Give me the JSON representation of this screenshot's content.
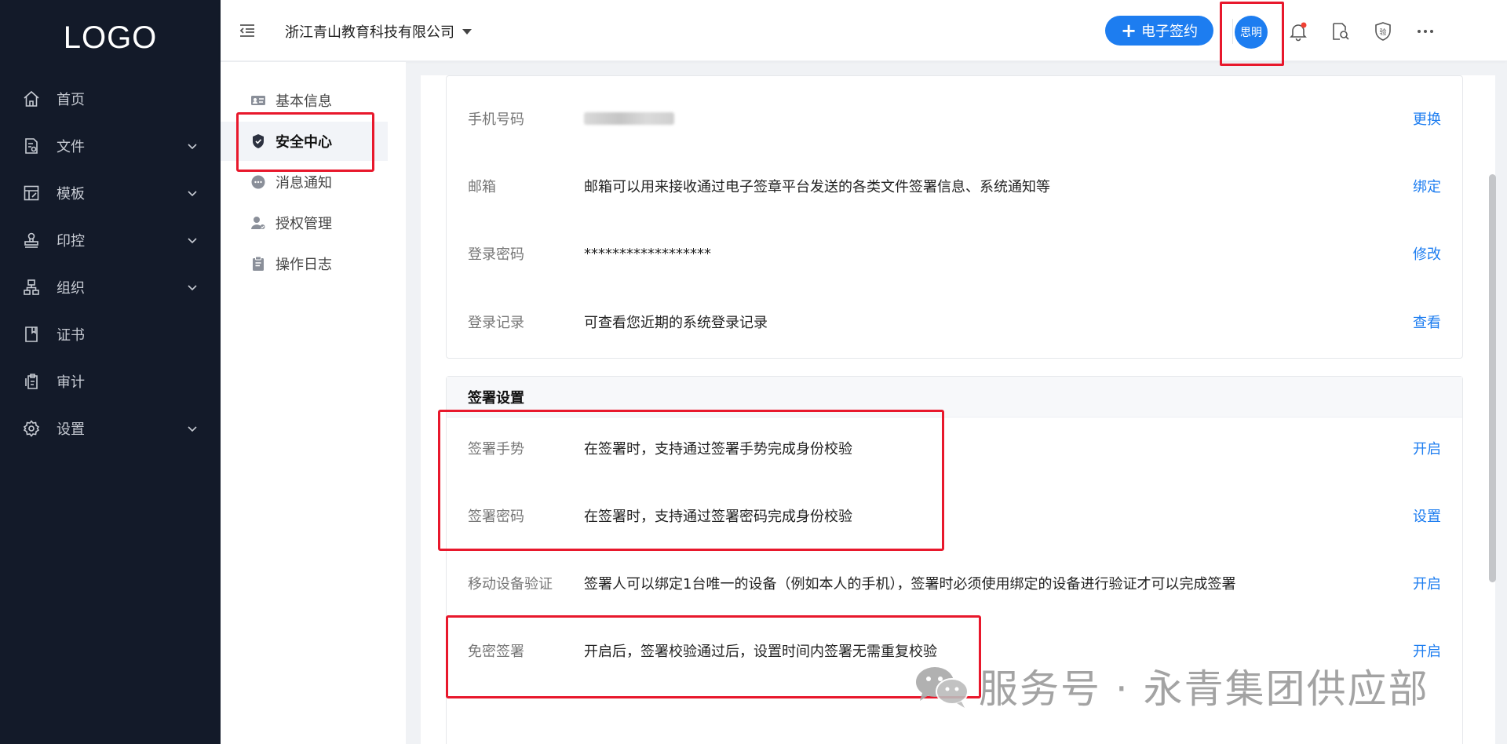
{
  "sidebar": {
    "logo": "LOGO",
    "items": [
      {
        "label": "首页",
        "icon": "home-icon",
        "has_children": false
      },
      {
        "label": "文件",
        "icon": "file-icon",
        "has_children": true
      },
      {
        "label": "模板",
        "icon": "template-icon",
        "has_children": true
      },
      {
        "label": "印控",
        "icon": "stamp-icon",
        "has_children": true
      },
      {
        "label": "组织",
        "icon": "org-icon",
        "has_children": true
      },
      {
        "label": "证书",
        "icon": "certificate-icon",
        "has_children": false
      },
      {
        "label": "审计",
        "icon": "audit-icon",
        "has_children": false
      },
      {
        "label": "设置",
        "icon": "settings-icon",
        "has_children": true
      }
    ]
  },
  "header": {
    "company": "浙江青山教育科技有限公司",
    "esign_button": "电子签约",
    "avatar_text": "思明",
    "icons": [
      "task-check-icon",
      "bell-icon",
      "doc-search-icon",
      "verify-shield-icon",
      "more-icon"
    ]
  },
  "subnav": {
    "items": [
      {
        "label": "基本信息",
        "icon": "id-card-icon",
        "active": false
      },
      {
        "label": "安全中心",
        "icon": "shield-icon",
        "active": true
      },
      {
        "label": "消息通知",
        "icon": "message-icon",
        "active": false
      },
      {
        "label": "授权管理",
        "icon": "user-auth-icon",
        "active": false
      },
      {
        "label": "操作日志",
        "icon": "log-icon",
        "active": false
      }
    ]
  },
  "account": {
    "rows": [
      {
        "label": "手机号码",
        "value": "",
        "action": "更换"
      },
      {
        "label": "邮箱",
        "value": "邮箱可以用来接收通过电子签章平台发送的各类文件签署信息、系统通知等",
        "action": "绑定"
      },
      {
        "label": "登录密码",
        "value": "******************",
        "action": "修改"
      },
      {
        "label": "登录记录",
        "value": "可查看您近期的系统登录记录",
        "action": "查看"
      }
    ]
  },
  "signing": {
    "title": "签署设置",
    "rows": [
      {
        "label": "签署手势",
        "value": "在签署时，支持通过签署手势完成身份校验",
        "action": "开启"
      },
      {
        "label": "签署密码",
        "value": "在签署时，支持通过签署密码完成身份校验",
        "action": "设置"
      },
      {
        "label": "移动设备验证",
        "value": "签署人可以绑定1台唯一的设备（例如本人的手机），签署时必须使用绑定的设备进行验证才可以完成签署",
        "action": "开启"
      },
      {
        "label": "免密签署",
        "value": "开启后，签署校验通过后，设置时间内签署无需重复校验",
        "action": "开启"
      }
    ]
  },
  "watermark": "服务号 · 永青集团供应部",
  "colors": {
    "primary": "#1d7df0",
    "sidebar_bg": "#131a29",
    "annotation": "#e8182c"
  }
}
